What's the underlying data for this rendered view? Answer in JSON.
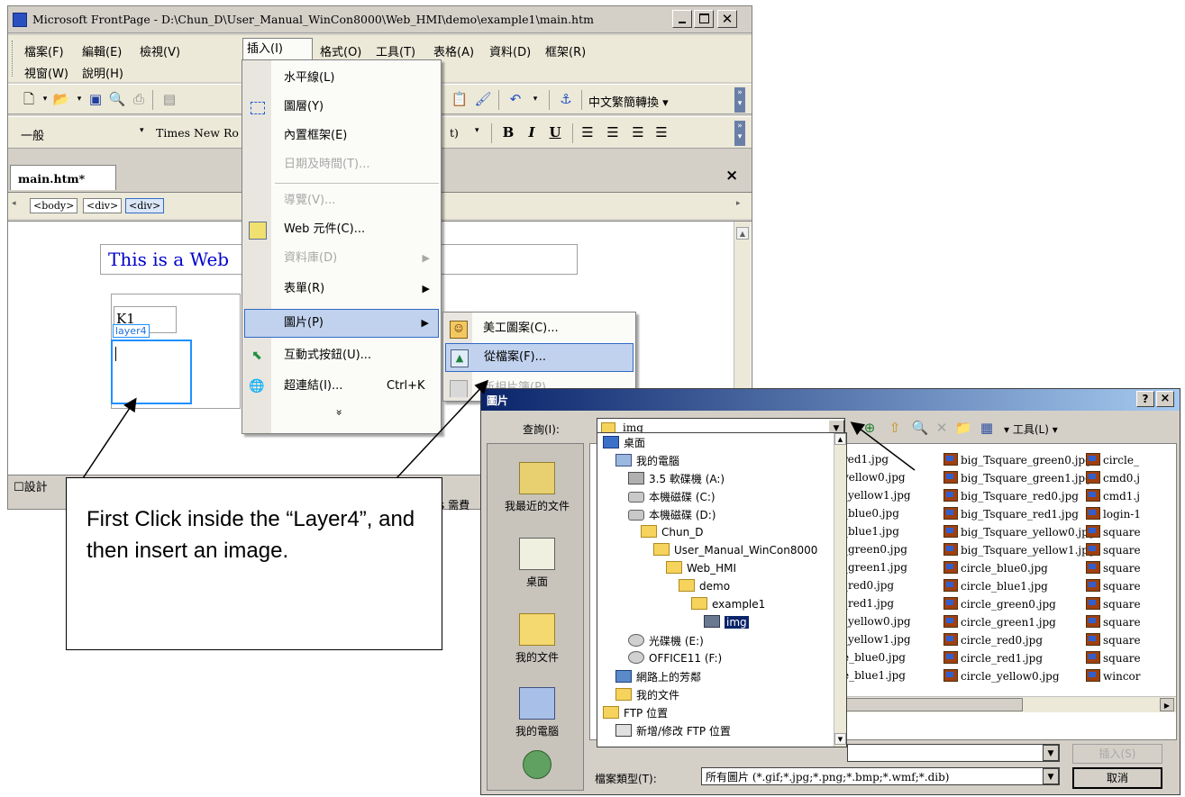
{
  "frontpage": {
    "title": "Microsoft FrontPage - D:\\Chun_D\\User_Manual_WinCon8000\\Web_HMI\\demo\\example1\\main.htm",
    "menu_row1": [
      "檔案(F)",
      "編輯(E)",
      "檢視(V)",
      "插入(I)",
      "格式(O)",
      "工具(T)",
      "表格(A)",
      "資料(D)",
      "框架(R)"
    ],
    "menu_row2": [
      "視窗(W)",
      "說明(H)"
    ],
    "style_value": "一般",
    "font_value": "Times New Ro",
    "size_fragment": "t)",
    "convert_button": "中文繁簡轉換",
    "doc_tab": "main.htm*",
    "close_glyph": "×",
    "tags": [
      "<body>",
      "<div>",
      "<div>"
    ],
    "page_text": "This is a Web",
    "k1_text": "K1",
    "layer_label": "layer4",
    "design_tab": "設計",
    "status_fragment": "s 需費"
  },
  "insert_menu": {
    "items": [
      {
        "label": "水平線(L)",
        "disabled": false,
        "icon": "",
        "submenu": false
      },
      {
        "label": "圖層(Y)",
        "disabled": false,
        "icon": "layer-icon",
        "submenu": false
      },
      {
        "label": "內置框架(E)",
        "disabled": false,
        "icon": "",
        "submenu": false
      },
      {
        "label": "日期及時間(T)...",
        "disabled": true,
        "icon": "",
        "submenu": false
      },
      {
        "label": "導覽(V)...",
        "disabled": true,
        "icon": "",
        "submenu": false
      },
      {
        "label": "Web 元件(C)...",
        "disabled": false,
        "icon": "web-component-icon",
        "submenu": false
      },
      {
        "label": "資料庫(D)",
        "disabled": true,
        "icon": "",
        "submenu": true
      },
      {
        "label": "表單(R)",
        "disabled": false,
        "icon": "",
        "submenu": true
      },
      {
        "label": "圖片(P)",
        "disabled": false,
        "icon": "",
        "submenu": true,
        "highlighted": true
      },
      {
        "label": "互動式按鈕(U)...",
        "disabled": false,
        "icon": "interactive-button-icon",
        "submenu": false
      },
      {
        "label": "超連結(I)...",
        "disabled": false,
        "icon": "hyperlink-icon",
        "submenu": false,
        "shortcut": "Ctrl+K"
      }
    ],
    "expand_glyph": "»"
  },
  "picture_submenu": {
    "items": [
      "美工圖案(C)...",
      "從檔案(F)...",
      "新相片簿(P)..."
    ]
  },
  "dialog": {
    "title": "圖片",
    "help_button": "?",
    "close_button": "×",
    "look_in_label": "查詢(I):",
    "look_in_value": "img",
    "tools_label": "工具(L)",
    "places": [
      "我最近的文件",
      "桌面",
      "我的文件",
      "我的電腦",
      ""
    ],
    "tree": [
      {
        "label": "桌面",
        "level": 0,
        "kind": "desktop"
      },
      {
        "label": "我的電腦",
        "level": 1,
        "kind": "computer"
      },
      {
        "label": "3.5 軟碟機 (A:)",
        "level": 2,
        "kind": "floppy"
      },
      {
        "label": "本機磁碟 (C:)",
        "level": 2,
        "kind": "drive"
      },
      {
        "label": "本機磁碟 (D:)",
        "level": 2,
        "kind": "drive"
      },
      {
        "label": "Chun_D",
        "level": 3,
        "kind": "folder"
      },
      {
        "label": "User_Manual_WinCon8000",
        "level": 4,
        "kind": "folder"
      },
      {
        "label": "Web_HMI",
        "level": 5,
        "kind": "folder"
      },
      {
        "label": "demo",
        "level": 6,
        "kind": "folder"
      },
      {
        "label": "example1",
        "level": 7,
        "kind": "folder"
      },
      {
        "label": "img",
        "level": 8,
        "kind": "folder-selected"
      },
      {
        "label": "光碟機 (E:)",
        "level": 2,
        "kind": "cd"
      },
      {
        "label": "OFFICE11 (F:)",
        "level": 2,
        "kind": "cd"
      },
      {
        "label": "網路上的芳鄰",
        "level": 1,
        "kind": "network"
      },
      {
        "label": "我的文件",
        "level": 1,
        "kind": "folder"
      },
      {
        "label": "FTP 位置",
        "level": 0,
        "kind": "folder"
      },
      {
        "label": "新增/修改 FTP 位置",
        "level": 1,
        "kind": "ftp"
      }
    ],
    "files_col1": [
      "red1.jpg",
      "yellow0.jpg",
      "_yellow1.jpg",
      "_blue0.jpg",
      "_blue1.jpg",
      "_green0.jpg",
      "_green1.jpg",
      "_red0.jpg",
      "_red1.jpg",
      "_yellow0.jpg",
      "_yellow1.jpg",
      "e_blue0.jpg",
      "e_blue1.jpg"
    ],
    "files_col2": [
      "big_Tsquare_green0.jpg",
      "big_Tsquare_green1.jpg",
      "big_Tsquare_red0.jpg",
      "big_Tsquare_red1.jpg",
      "big_Tsquare_yellow0.jpg",
      "big_Tsquare_yellow1.jpg",
      "circle_blue0.jpg",
      "circle_blue1.jpg",
      "circle_green0.jpg",
      "circle_green1.jpg",
      "circle_red0.jpg",
      "circle_red1.jpg",
      "circle_yellow0.jpg"
    ],
    "files_col3": [
      "circle_",
      "cmd0.j",
      "cmd1.j",
      "login-1",
      "square",
      "square",
      "square",
      "square",
      "square",
      "square",
      "square",
      "square",
      "wincor"
    ],
    "filetype_label": "檔案類型(T):",
    "filetype_value": "所有圖片 (*.gif;*.jpg;*.png;*.bmp;*.wmf;*.dib)",
    "insert_button": "插入(S)",
    "cancel_button": "取消"
  },
  "callout": {
    "text": "First Click inside the “Layer4”, and then insert an image."
  },
  "colors": {
    "title_blue": "#0a246a",
    "highlight": "#c1d2ee",
    "highlight_border": "#316ac5",
    "page_text": "#0000cc",
    "layer_border": "#1e90ff"
  }
}
